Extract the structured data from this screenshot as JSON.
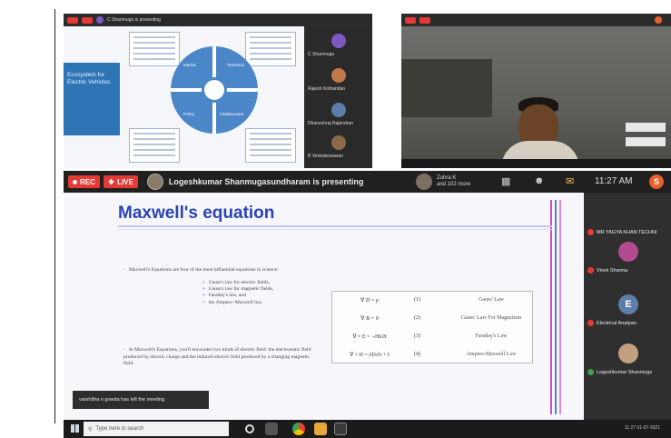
{
  "thumb_left": {
    "title": "C Shanmuga is presenting",
    "rec_label": "REC",
    "live_label": "LIVE",
    "slide_title": "Ecosystem for Electric Vehicles",
    "quadrants": [
      "Market",
      "Technical",
      "Policy",
      "Infrastructure"
    ],
    "participants": [
      "C Shanmuga",
      "Rajesh Kothandan",
      "Dhaneshraj Rajendran",
      "B Venkateswaran"
    ]
  },
  "main": {
    "rec_label": "REC",
    "live_label": "LIVE",
    "presenter_text": "Logeshkumar Shanmugasundharam is presenting",
    "viewers_text_1": "Zuhra K",
    "viewers_text_2": "and 102 more",
    "clock": "11:27 AM",
    "user_initial": "S",
    "slide_title": "Maxwell's equation",
    "para1": "Maxwell's Equations are four of the most influential equations in science:",
    "laws": [
      "Gauss's law for electric fields,",
      "Gauss's law for magnetic fields,",
      "Faraday's law, and",
      "the Ampere- Maxwell law."
    ],
    "para2": "In Maxwell's Equations, you'll encounter two kinds of electric field: the electrostatic field produced by electric charge and the induced electric field produced by a changing magnetic field.",
    "equations": [
      {
        "eq": "∇·D = ρ",
        "num": "(1)",
        "name": "Gauss' Law"
      },
      {
        "eq": "∇·B = 0",
        "num": "(2)",
        "name": "Gauss' Law For Magnetism"
      },
      {
        "eq": "∇ × E = −∂B/∂t",
        "num": "(3)",
        "name": "Faraday's Law"
      },
      {
        "eq": "∇ × H = ∂D/∂t + J",
        "num": "(4)",
        "name": "Ampere-Maxwell Law"
      }
    ],
    "toast": "varshitha n gowda has left the meeting"
  },
  "participants_panel": [
    {
      "name": "MR YAGYA KHAN TECHNI",
      "color": "#9c7a5a",
      "mic": "red"
    },
    {
      "name": "Vivek Sharma",
      "color": "#b34c8e",
      "mic": "red"
    },
    {
      "name": "Electrical Analysis",
      "color": "#5b7fa8",
      "initial": "E",
      "mic": "red"
    },
    {
      "name": "Logeshkumar Shanmugs",
      "color": "#c2a080",
      "mic": "green"
    }
  ],
  "taskbar": {
    "search_placeholder": "Type here to search",
    "tray_time": "11:27",
    "tray_date": "01-07-2021"
  }
}
